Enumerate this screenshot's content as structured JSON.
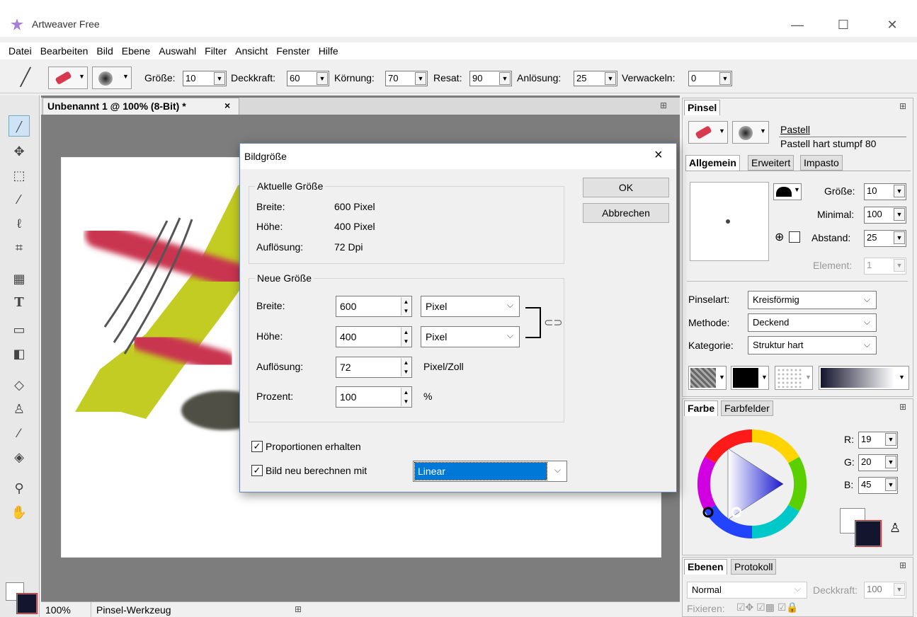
{
  "app": {
    "title": "Artweaver Free"
  },
  "menu": [
    "Datei",
    "Bearbeiten",
    "Bild",
    "Ebene",
    "Auswahl",
    "Filter",
    "Ansicht",
    "Fenster",
    "Hilfe"
  ],
  "toolbar": {
    "groesse_label": "Größe:",
    "groesse": "10",
    "deckkraft_label": "Deckkraft:",
    "deckkraft": "60",
    "koernung_label": "Körnung:",
    "koernung": "70",
    "resat_label": "Resat:",
    "resat": "90",
    "anloesung_label": "Anlösung:",
    "anloesung": "25",
    "verwackeln_label": "Verwackeln:",
    "verwackeln": "0"
  },
  "document": {
    "tab": "Unbenannt 1 @ 100% (8-Bit) *",
    "close": "×",
    "zoom": "100%",
    "tool": "Pinsel-Werkzeug"
  },
  "dialog": {
    "title": "Bildgröße",
    "close": "×",
    "current": {
      "title": "Aktuelle Größe",
      "breite_label": "Breite:",
      "breite": "600 Pixel",
      "hoehe_label": "Höhe:",
      "hoehe": "400 Pixel",
      "aufl_label": "Auflösung:",
      "aufl": "72 Dpi"
    },
    "new": {
      "title": "Neue Größe",
      "breite_label": "Breite:",
      "breite": "600",
      "breite_unit": "Pixel",
      "hoehe_label": "Höhe:",
      "hoehe": "400",
      "hoehe_unit": "Pixel",
      "aufl_label": "Auflösung:",
      "aufl": "72",
      "aufl_unit": "Pixel/Zoll",
      "prozent_label": "Prozent:",
      "prozent": "100",
      "prozent_unit": "%"
    },
    "proportionen": "Proportionen erhalten",
    "neu_berechnen": "Bild neu berechnen mit",
    "method": "Linear",
    "ok": "OK",
    "cancel": "Abbrechen"
  },
  "brush_panel": {
    "title": "Pinsel",
    "category": "Pastell",
    "name": "Pastell hart stumpf 80",
    "tabs": [
      "Allgemein",
      "Erweitert",
      "Impasto"
    ],
    "groesse_label": "Größe:",
    "groesse": "10",
    "minimal_label": "Minimal:",
    "minimal": "100",
    "abstand_label": "Abstand:",
    "abstand": "25",
    "element_label": "Element:",
    "element": "1",
    "pinselart_label": "Pinselart:",
    "pinselart": "Kreisförmig",
    "methode_label": "Methode:",
    "methode": "Deckend",
    "kategorie_label": "Kategorie:",
    "kategorie": "Struktur hart"
  },
  "color_panel": {
    "tabs": [
      "Farbe",
      "Farbfelder"
    ],
    "r_label": "R:",
    "r": "19",
    "g_label": "G:",
    "g": "20",
    "b_label": "B:",
    "b": "45",
    "fg": "#13142d"
  },
  "layers_panel": {
    "tabs": [
      "Ebenen",
      "Protokoll"
    ],
    "mode": "Normal",
    "deckkraft_label": "Deckkraft:",
    "deckkraft": "100",
    "fixieren_label": "Fixieren:"
  }
}
